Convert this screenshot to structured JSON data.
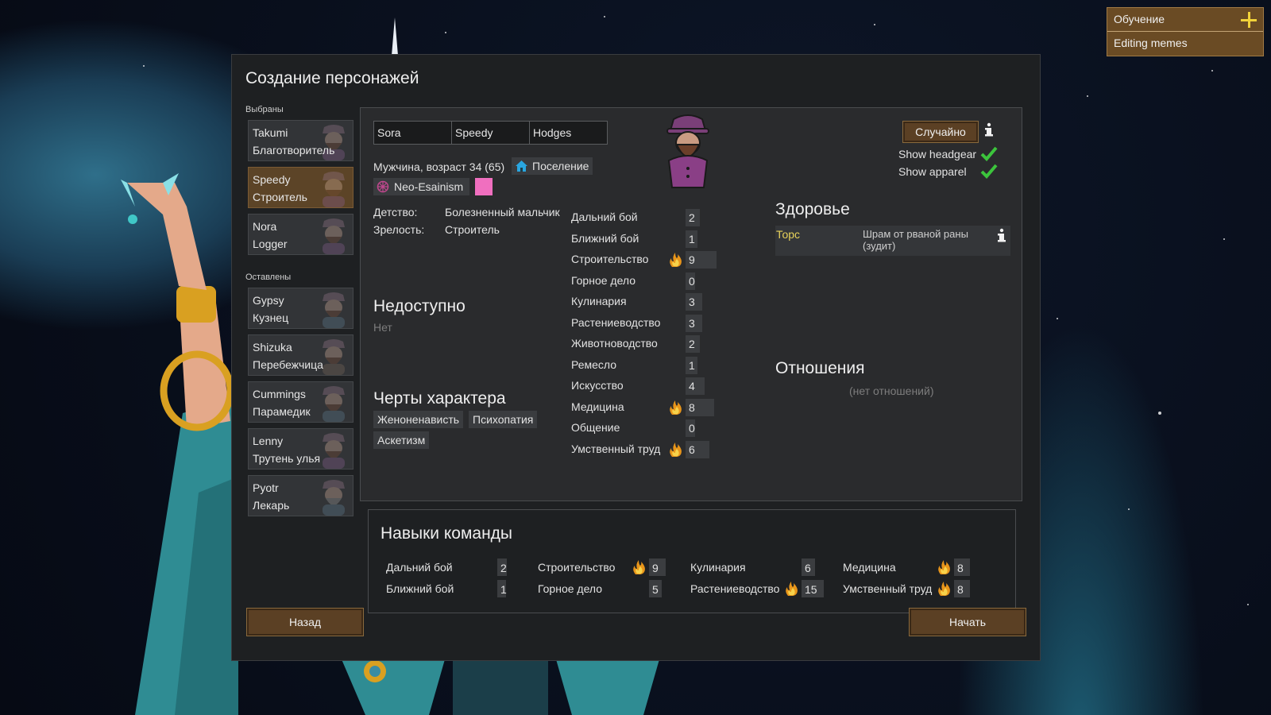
{
  "tutorial": {
    "title": "Обучение",
    "item": "Editing memes"
  },
  "window": {
    "title": "Создание персонажей",
    "chosen_label": "Выбраны",
    "left_label": "Оставлены",
    "chosen": [
      {
        "name": "Takumi",
        "job": "Благотворитель",
        "selected": false
      },
      {
        "name": "Speedy",
        "job": "Строитель",
        "selected": true
      },
      {
        "name": "Nora",
        "job": "Logger",
        "selected": false
      }
    ],
    "left": [
      {
        "name": "Gypsy",
        "job": "Кузнец"
      },
      {
        "name": "Shizuka",
        "job": "Перебежчица"
      },
      {
        "name": "Cummings",
        "job": "Парамедик"
      },
      {
        "name": "Lenny",
        "job": "Трутень улья"
      },
      {
        "name": "Pyotr",
        "job": "Лекарь"
      }
    ],
    "back_button": "Назад",
    "start_button": "Начать"
  },
  "character": {
    "first_name": "Sora",
    "nick_name": "Speedy",
    "last_name": "Hodges",
    "random_button": "Случайно",
    "show_headgear": "Show headgear",
    "show_apparel": "Show apparel",
    "description": "Мужчина, возраст 34 (65)",
    "faction": "Поселение",
    "ideology": "Neo-Esainism",
    "ideology_color": "#f06fbf",
    "childhood_label": "Детство:",
    "childhood": "Болезненный мальчик",
    "adulthood_label": "Зрелость:",
    "adulthood": "Строитель",
    "incapable_title": "Недоступно",
    "incapable_value": "Нет",
    "traits_title": "Черты характера",
    "traits": [
      "Женоненависть",
      "Психопатия",
      "Аскетизм"
    ],
    "skills": [
      {
        "name": "Дальний бой",
        "value": "2",
        "passion": 0
      },
      {
        "name": "Ближний бой",
        "value": "1",
        "passion": 0
      },
      {
        "name": "Строительство",
        "value": "9",
        "passion": 2
      },
      {
        "name": "Горное дело",
        "value": "0",
        "passion": 0
      },
      {
        "name": "Кулинария",
        "value": "3",
        "passion": 0
      },
      {
        "name": "Растениеводство",
        "value": "3",
        "passion": 0
      },
      {
        "name": "Животноводство",
        "value": "2",
        "passion": 0
      },
      {
        "name": "Ремесло",
        "value": "1",
        "passion": 0
      },
      {
        "name": "Искусство",
        "value": "4",
        "passion": 0
      },
      {
        "name": "Медицина",
        "value": "8",
        "passion": 2
      },
      {
        "name": "Общение",
        "value": "0",
        "passion": 0
      },
      {
        "name": "Умственный труд",
        "value": "6",
        "passion": 2
      }
    ],
    "health_title": "Здоровье",
    "health": {
      "part": "Торс",
      "condition": "Шрам от рваной раны (зудит)"
    },
    "relations_title": "Отношения",
    "relations_empty": "(нет отношений)"
  },
  "team": {
    "title": "Навыки команды",
    "skills": [
      {
        "name": "Дальний бой",
        "value": "2",
        "passion": false
      },
      {
        "name": "Ближний бой",
        "value": "1",
        "passion": false
      },
      {
        "name": "Строительство",
        "value": "9",
        "passion": true
      },
      {
        "name": "Горное дело",
        "value": "5",
        "passion": false
      },
      {
        "name": "Кулинария",
        "value": "6",
        "passion": false
      },
      {
        "name": "Растениеводство",
        "value": "15",
        "passion": true
      },
      {
        "name": "Медицина",
        "value": "8",
        "passion": true
      },
      {
        "name": "Умственный труд",
        "value": "8",
        "passion": true
      }
    ]
  },
  "colors": {
    "health_part": "#e8d25a",
    "wood": "#5b4024"
  }
}
